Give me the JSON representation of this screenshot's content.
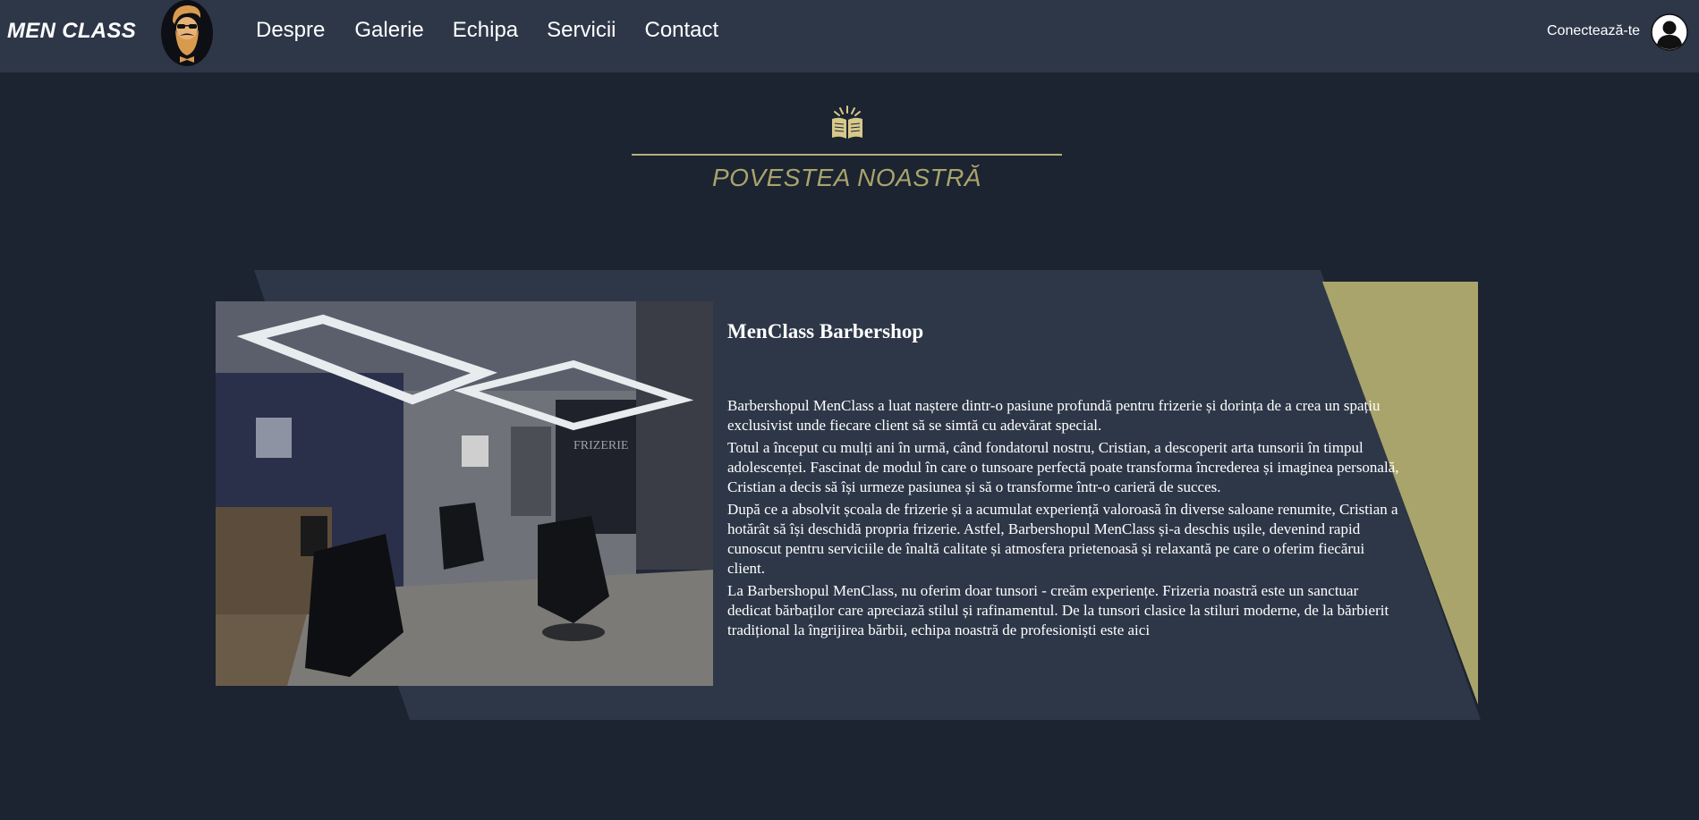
{
  "nav": {
    "brand": "MEN CLASS",
    "logo_icon": "bearded-man-logo-icon",
    "links": [
      "Despre",
      "Galerie",
      "Echipa",
      "Servicii",
      "Contact"
    ],
    "login_label": "Conectează-te",
    "avatar_icon": "user-avatar-icon"
  },
  "section": {
    "icon": "open-book-icon",
    "title": "POVESTEA NOASTRĂ"
  },
  "story": {
    "image_icon": "barbershop-interior-photo",
    "title": "MenClass Barbershop",
    "paragraphs": [
      "Barbershopul MenClass a luat naștere dintr-o pasiune profundă pentru frizerie și dorința de a crea un spațiu exclusivist unde fiecare client să se simtă cu adevărat special.",
      "Totul a început cu mulți ani în urmă, când fondatorul nostru, Cristian, a descoperit arta tunsorii în timpul adolescenței. Fascinat de modul în care o tunsoare perfectă poate transforma încrederea și imaginea personală, Cristian a decis să își urmeze pasiunea și să o transforme într-o carieră de succes.",
      "După ce a absolvit școala de frizerie și a acumulat experiență valoroasă în diverse saloane renumite, Cristian a hotărât să își deschidă propria frizerie. Astfel, Barbershopul MenClass și-a deschis ușile, devenind rapid cunoscut pentru serviciile de înaltă calitate și atmosfera prietenoasă și relaxantă pe care o oferim fiecărui client.",
      "La Barbershopul MenClass, nu oferim doar tunsori - creăm experiențe. Frizeria noastră este un sanctuar dedicat bărbaților care apreciază stilul și rafinamentul. De la tunsori clasice la stiluri moderne, de la bărbierit tradițional la îngrijirea bărbii, echipa noastră de profesioniști este aici"
    ]
  },
  "colors": {
    "page_bg": "#1c2331",
    "nav_bg": "#2e3748",
    "card_bg": "#2e3748",
    "accent_gold": "#a9a46b",
    "text": "#ffffff"
  }
}
